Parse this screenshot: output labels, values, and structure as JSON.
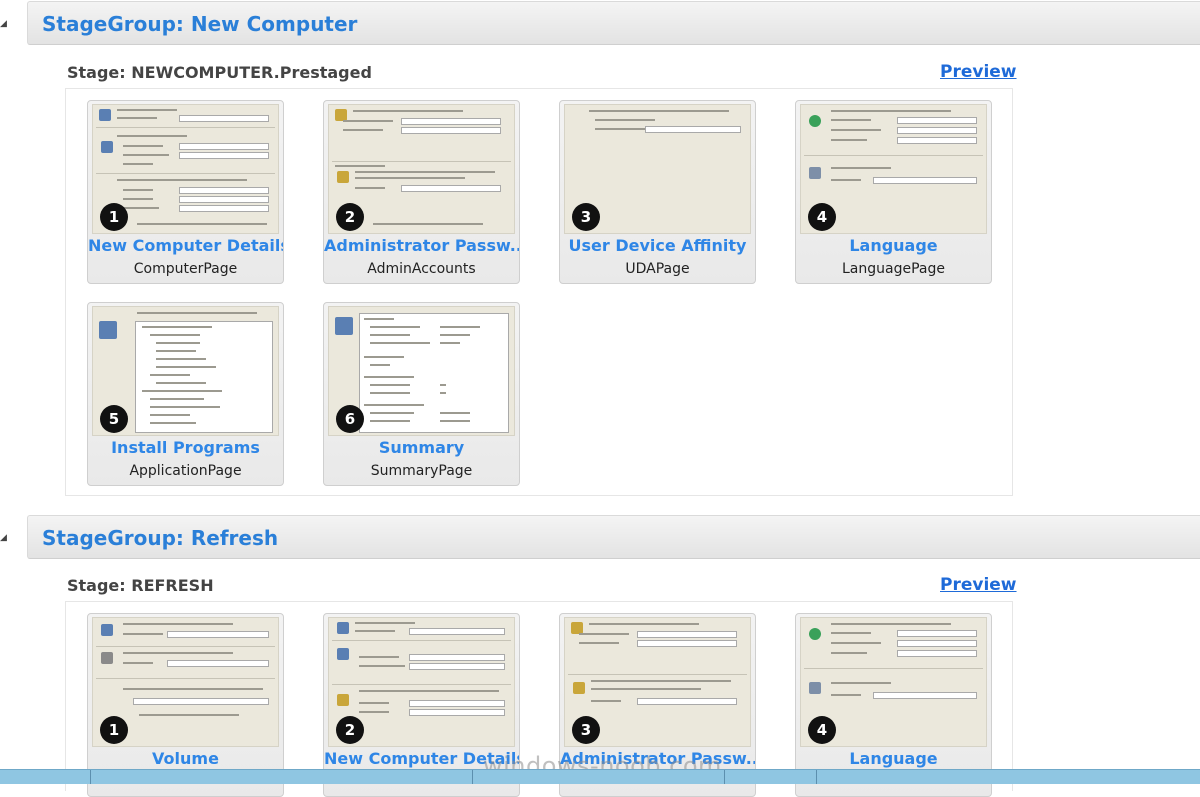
{
  "groups": [
    {
      "title": "StageGroup: New Computer",
      "stage": "Stage: NEWCOMPUTER.Prestaged",
      "preview": "Preview",
      "pages": [
        {
          "number": "1",
          "title": "New Computer Details",
          "subtitle": "ComputerPage"
        },
        {
          "number": "2",
          "title": "Administrator Passw...",
          "subtitle": "AdminAccounts"
        },
        {
          "number": "3",
          "title": "User Device Affinity",
          "subtitle": "UDAPage"
        },
        {
          "number": "4",
          "title": "Language",
          "subtitle": "LanguagePage"
        },
        {
          "number": "5",
          "title": "Install Programs",
          "subtitle": "ApplicationPage"
        },
        {
          "number": "6",
          "title": "Summary",
          "subtitle": "SummaryPage"
        }
      ]
    },
    {
      "title": "StageGroup: Refresh",
      "stage": "Stage: REFRESH",
      "preview": "Preview",
      "pages": [
        {
          "number": "1",
          "title": "Volume",
          "subtitle": ""
        },
        {
          "number": "2",
          "title": "New Computer Details",
          "subtitle": ""
        },
        {
          "number": "3",
          "title": "Administrator Passw...",
          "subtitle": ""
        },
        {
          "number": "4",
          "title": "Language",
          "subtitle": ""
        }
      ]
    }
  ],
  "icons": {
    "expand": "collapse-triangle-icon"
  },
  "colors": {
    "accent": "#2f86e6",
    "header_bg": "#ececec",
    "thumb_bg": "#ebe8dc",
    "badge": "#111111"
  },
  "watermark": "windows-noob.com"
}
